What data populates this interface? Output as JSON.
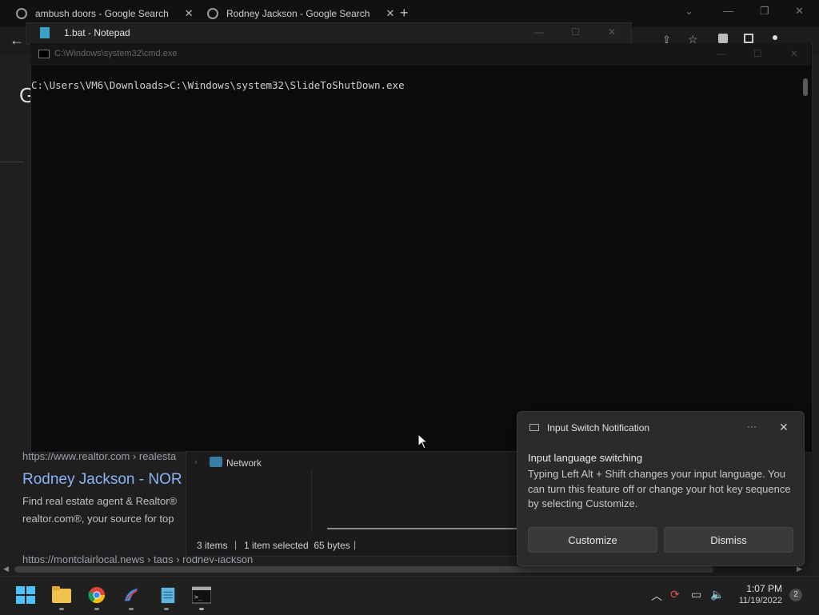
{
  "browser": {
    "tabs": [
      {
        "title": "ambush doors - Google Search"
      },
      {
        "title": "Rodney Jackson - Google Search"
      }
    ],
    "new_tab": "+",
    "results": {
      "url1": "https://www.realtor.com › realesta",
      "title1": "Rodney Jackson - NOR",
      "snippet1a": "Find real estate agent & Realtor®",
      "snippet1b": "realtor.com®, your source for top",
      "url2": "https://montclairlocal.news › tags › rodney-jackson"
    }
  },
  "notepad": {
    "title": "1.bat - Notepad"
  },
  "cmd": {
    "title": "C:\\Windows\\system32\\cmd.exe",
    "line": "C:\\Users\\VM6\\Downloads>C:\\Windows\\system32\\SlideToShutDown.exe"
  },
  "explorer": {
    "nav_item": "Network",
    "status_items": "3 items",
    "status_selected": "1 item selected  65 bytes"
  },
  "notification": {
    "app": "Input Switch Notification",
    "heading": "Input language switching",
    "body": "Typing Left Alt + Shift changes your input language. You can turn this feature off or change your hot key sequence by selecting Customize.",
    "customize": "Customize",
    "dismiss": "Dismiss",
    "more": "···",
    "close": "✕"
  },
  "taskbar": {
    "time": "1:07 PM",
    "date": "11/19/2022",
    "notification_count": "2",
    "apps": [
      "start-icon",
      "file-explorer-icon",
      "chrome-icon",
      "app-icon",
      "notepad-icon",
      "terminal-icon"
    ]
  }
}
